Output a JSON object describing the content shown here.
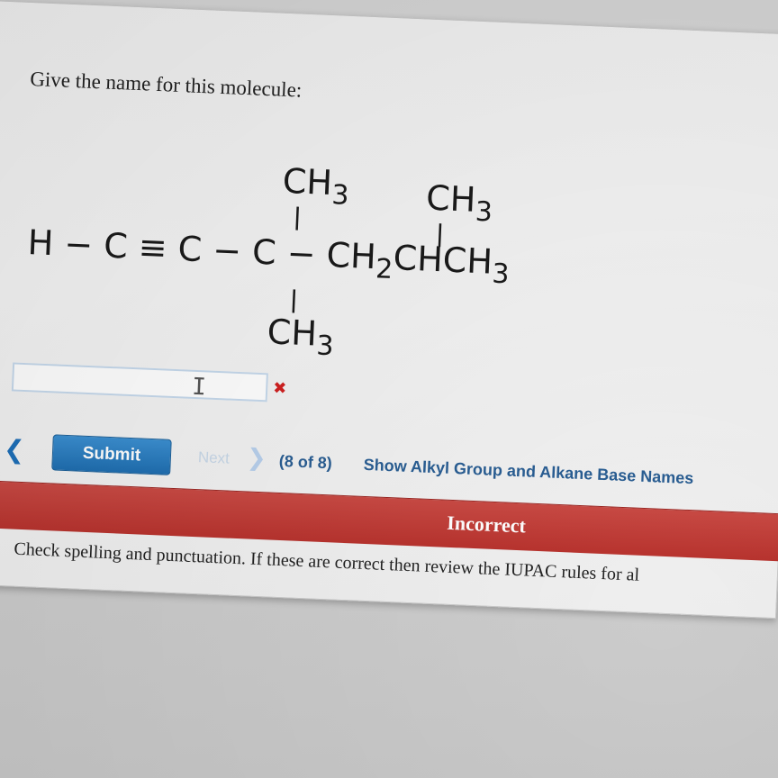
{
  "question": {
    "prompt": "Give the name for this molecule:"
  },
  "molecule": {
    "top_left_group": "CH",
    "top_left_sub": "3",
    "top_right_group": "CH",
    "top_right_sub": "3",
    "bottom_group": "CH",
    "bottom_sub": "3",
    "chain_start": "H − C ≡ C − C − CH",
    "chain_sub_2": "2",
    "chain_mid": "CHCH",
    "chain_sub_3": "3"
  },
  "answer": {
    "value": "",
    "status_icon": "x-mark-icon"
  },
  "nav": {
    "back_glyph": "❮",
    "submit_label": "Submit",
    "next_label": "Next",
    "next_glyph": "❯",
    "progress": "(8 of 8)",
    "hint_label": "Show Alkyl Group and Alkane Base Names"
  },
  "result": {
    "banner": "Incorrect",
    "feedback": "Check spelling and punctuation. If these are correct then review the IUPAC rules for al"
  },
  "colors": {
    "accent": "#1f6eb0",
    "error": "#b8332e",
    "link": "#2a5e93"
  }
}
